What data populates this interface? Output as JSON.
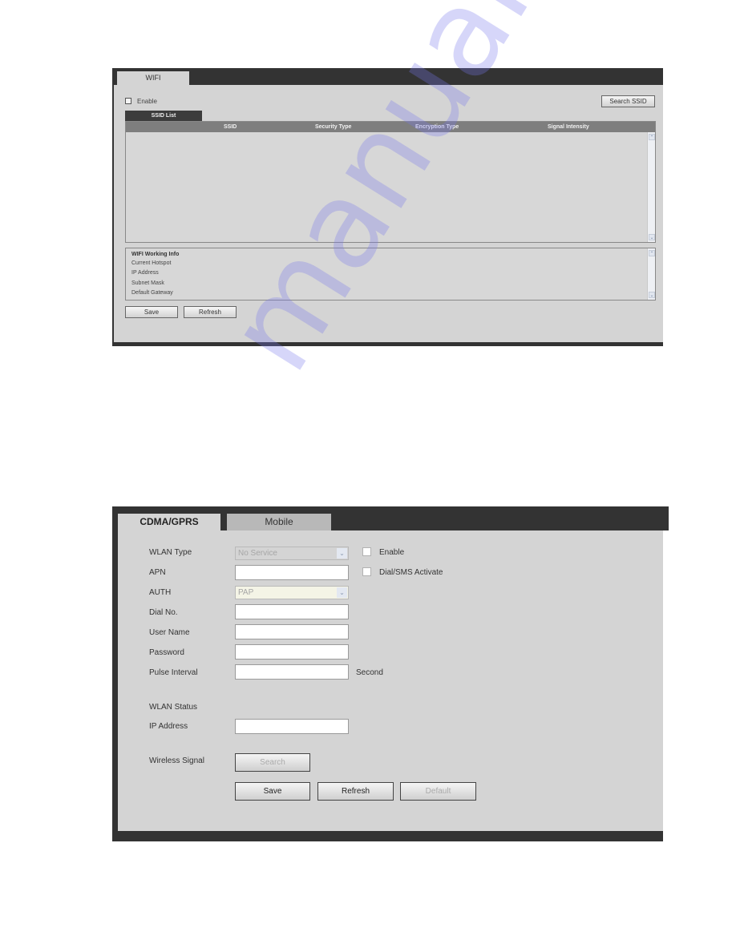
{
  "wifi_panel": {
    "tab_label": "WIFI",
    "enable_label": "Enable",
    "enable_checked": false,
    "search_ssid_label": "Search SSID",
    "ssid_list_tab": "SSID List",
    "ssid_columns": [
      "SSID",
      "Security Type",
      "Encryption Type",
      "Signal Intensity"
    ],
    "ssid_rows": [],
    "working_info": {
      "title": "WIFI Working Info",
      "rows": [
        "Current Hotspot",
        "IP Address",
        "Subnet Mask",
        "Default Gateway"
      ]
    },
    "save_label": "Save",
    "refresh_label": "Refresh"
  },
  "mobile_panel": {
    "tabs": [
      {
        "label": "CDMA/GPRS",
        "active": true
      },
      {
        "label": "Mobile",
        "active": false
      }
    ],
    "fields": {
      "wlan_type": {
        "label": "WLAN Type",
        "value": "No Service"
      },
      "apn": {
        "label": "APN",
        "value": ""
      },
      "auth": {
        "label": "AUTH",
        "value": "PAP"
      },
      "dial_no": {
        "label": "Dial No.",
        "value": ""
      },
      "user_name": {
        "label": "User Name",
        "value": ""
      },
      "password": {
        "label": "Password",
        "value": ""
      },
      "pulse_interval": {
        "label": "Pulse Interval",
        "value": "",
        "unit": "Second"
      },
      "wlan_status": {
        "label": "WLAN Status"
      },
      "ip_address": {
        "label": "IP Address",
        "value": ""
      },
      "wireless_signal": {
        "label": "Wireless Signal"
      }
    },
    "enable_label": "Enable",
    "enable_checked": false,
    "dial_sms_label": "Dial/SMS Activate",
    "dial_sms_checked": false,
    "search_label": "Search",
    "save_label": "Save",
    "refresh_label": "Refresh",
    "default_label": "Default"
  },
  "watermark": "manualshive.com"
}
